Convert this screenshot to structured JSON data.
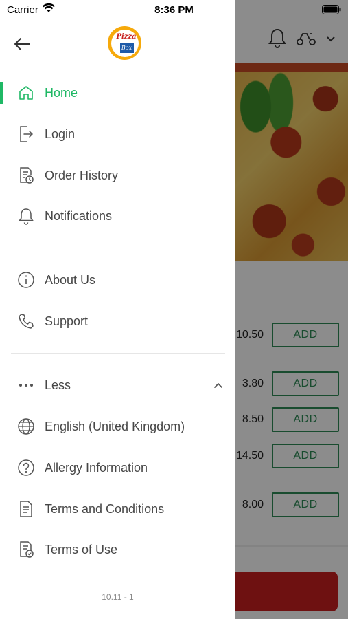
{
  "status_bar": {
    "carrier": "Carrier",
    "time": "8:36 PM"
  },
  "drawer": {
    "logo": {
      "text_top": "Pizza",
      "text_box": "Box"
    },
    "menu": [
      {
        "label": "Home",
        "icon": "home-icon",
        "active": true
      },
      {
        "label": "Login",
        "icon": "login-icon"
      },
      {
        "label": "Order History",
        "icon": "order-history-icon"
      },
      {
        "label": "Notifications",
        "icon": "bell-icon"
      },
      {
        "label": "About Us",
        "icon": "info-icon"
      },
      {
        "label": "Support",
        "icon": "phone-icon"
      },
      {
        "label": "Less",
        "icon": "more-dots-icon"
      },
      {
        "label": "English (United Kingdom)",
        "icon": "globe-icon"
      },
      {
        "label": "Allergy Information",
        "icon": "question-icon"
      },
      {
        "label": "Terms and Conditions",
        "icon": "document-icon"
      },
      {
        "label": "Terms of Use",
        "icon": "document-check-icon"
      }
    ],
    "version": "10.11 - 1"
  },
  "background": {
    "items": [
      {
        "price": "10.50",
        "button": "ADD"
      },
      {
        "price": "3.80",
        "button": "ADD"
      },
      {
        "price": "8.50",
        "button": "ADD"
      },
      {
        "price": "14.50",
        "button": "ADD"
      },
      {
        "price": "8.00",
        "button": "ADD"
      }
    ]
  },
  "colors": {
    "accent": "#1fb865",
    "add_button": "#2e8b57",
    "cta": "#c8201f",
    "overlay": "rgba(0,0,0,0.45)"
  }
}
